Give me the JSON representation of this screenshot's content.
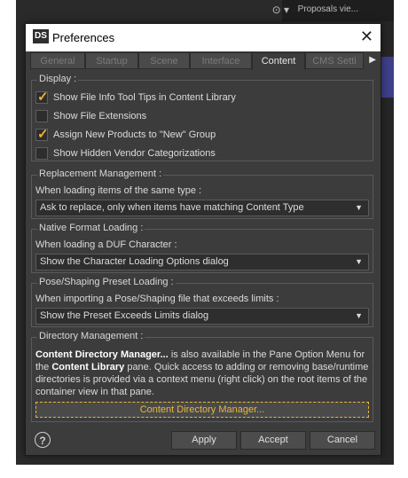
{
  "background": {
    "selection_text": "Proposals vie..."
  },
  "window": {
    "logo_text": "DS",
    "title": "Preferences",
    "close_symbol": "✕"
  },
  "tabs": [
    {
      "label": "General"
    },
    {
      "label": "Startup"
    },
    {
      "label": "Scene"
    },
    {
      "label": "Interface"
    },
    {
      "label": "Content",
      "active": true
    },
    {
      "label": "CMS Setti"
    }
  ],
  "tabs_scroll_symbol": "▶",
  "display": {
    "title": "Display :",
    "options": [
      {
        "label": "Show File Info Tool Tips in Content Library",
        "checked": true
      },
      {
        "label": "Show File Extensions",
        "checked": false
      },
      {
        "label": "Assign New Products to \"New\" Group",
        "checked": true
      },
      {
        "label": "Show Hidden Vendor Categorizations",
        "checked": false
      }
    ]
  },
  "replacement": {
    "title": "Replacement Management :",
    "label": "When loading items of the same type :",
    "value": "Ask to replace, only when items have matching Content Type"
  },
  "native_format": {
    "title": "Native Format Loading :",
    "label": "When loading a DUF Character :",
    "value": "Show the Character Loading Options dialog"
  },
  "pose_shaping": {
    "title": "Pose/Shaping Preset Loading :",
    "label": "When importing a Pose/Shaping file that exceeds limits :",
    "value": "Show the Preset Exceeds Limits dialog"
  },
  "directory": {
    "title": "Directory Management :",
    "bold1": "Content Directory Manager...",
    "text1": " is also available in the Pane Option Menu for the ",
    "bold2": "Content Library",
    "text2": " pane. Quick access to adding or removing base/runtime directories is provided via a context menu (right click) on the root items of the container view in that pane.",
    "button": "Content Directory Manager..."
  },
  "footer": {
    "help_symbol": "?",
    "apply": "Apply",
    "accept": "Accept",
    "cancel": "Cancel"
  },
  "colors": {
    "accent": "#e8b83c",
    "dialog_bg": "#3c3c3c"
  },
  "dropdown_arrow": "▼"
}
